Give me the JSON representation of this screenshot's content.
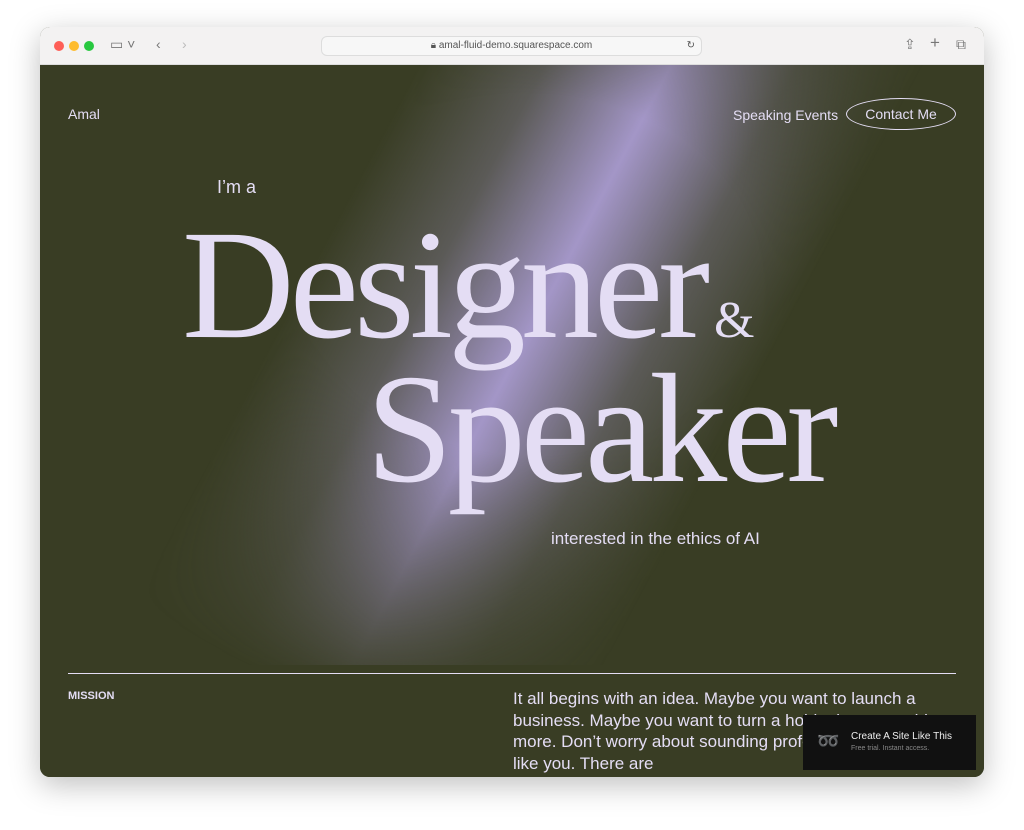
{
  "browser": {
    "url": "amal-fluid-demo.squarespace.com"
  },
  "site": {
    "logo": "Amal",
    "nav": [
      "Speaking Events"
    ],
    "contact": "Contact Me"
  },
  "hero": {
    "intro": "I’m a",
    "line1": "Designer",
    "amp": "&",
    "line2": "Speaker",
    "tagline": "interested in the ethics of AI"
  },
  "mission": {
    "label": "MISSION",
    "text": "It all begins with an idea. Maybe you want to launch a business. Maybe you want to turn a hobby into something more. Don’t worry about sounding professional. Sound like you. There are"
  },
  "promo": {
    "title": "Create A Site Like This",
    "subtitle": "Free trial. Instant access."
  },
  "colors": {
    "background": "#393d24",
    "text": "#e4ddf4",
    "accent": "#a99bd0"
  }
}
